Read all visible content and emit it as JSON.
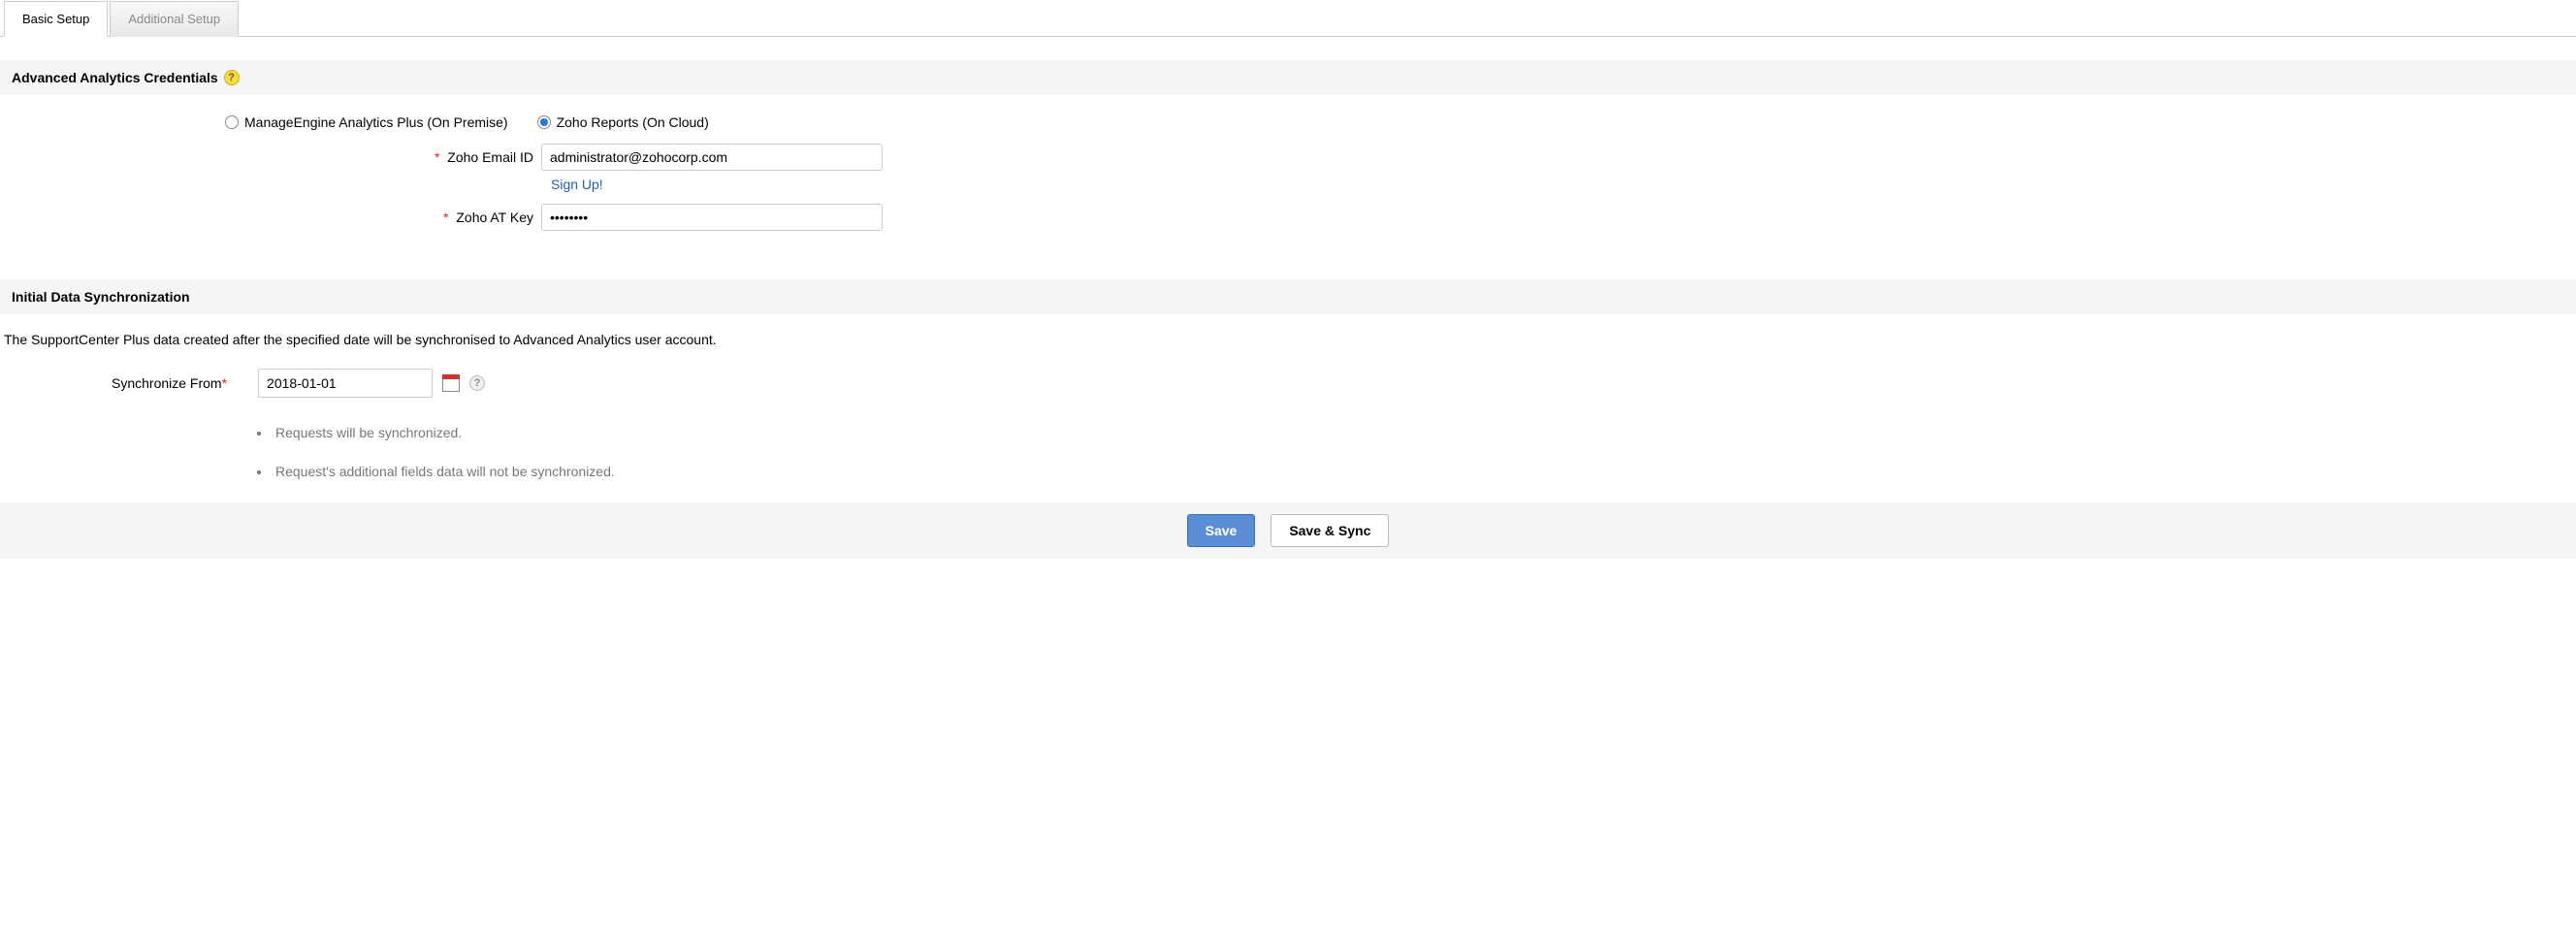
{
  "tabs": {
    "active": "Basic Setup",
    "inactive": "Additional Setup"
  },
  "sections": {
    "credentials_title": "Advanced Analytics Credentials",
    "sync_title": "Initial Data Synchronization"
  },
  "radio": {
    "on_premise": "ManageEngine Analytics Plus (On Premise)",
    "on_cloud": "Zoho Reports (On Cloud)",
    "selected": "on_cloud"
  },
  "fields": {
    "email_label": "Zoho Email ID",
    "email_value": "administrator@zohocorp.com",
    "signup_label": "Sign Up!",
    "atkey_label": "Zoho AT Key",
    "atkey_value": "••••••••"
  },
  "sync": {
    "description": "The SupportCenter Plus data created after the specified date will be synchronised to Advanced Analytics user account.",
    "from_label": "Synchronize From",
    "from_value": "2018-01-01",
    "notes": [
      "Requests will be synchronized.",
      "Request's additional fields data will not be synchronized."
    ]
  },
  "buttons": {
    "save": "Save",
    "save_sync": "Save & Sync"
  }
}
